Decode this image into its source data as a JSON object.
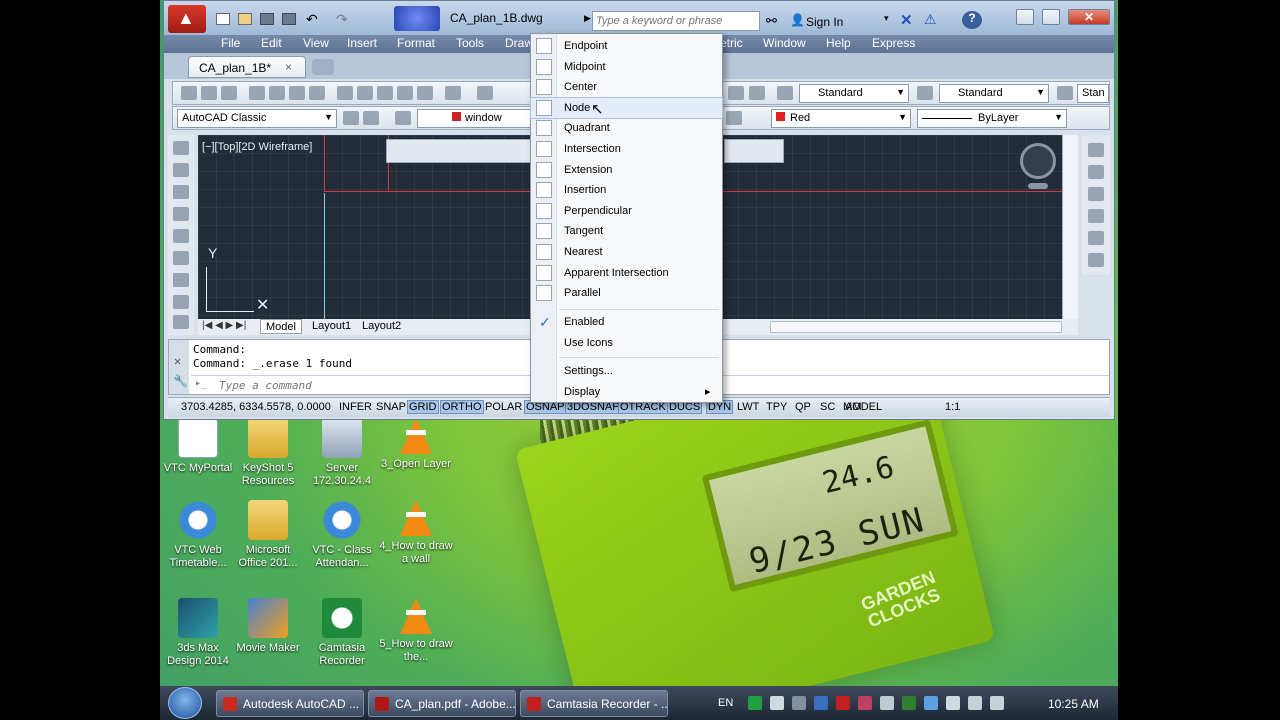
{
  "window": {
    "title": "CA_plan_1B.dwg",
    "search_placeholder": "Type a keyword or phrase",
    "sign_in": "Sign In"
  },
  "menus": [
    "File",
    "Edit",
    "View",
    "Insert",
    "Format",
    "Tools",
    "Draw",
    "etric",
    "Window",
    "Help",
    "Express"
  ],
  "file_tab": {
    "label": "CA_plan_1B*",
    "close": "×"
  },
  "toolbar": {
    "text_style": "Standard",
    "dim_style": "Standard",
    "table_style_partial": "Stan",
    "workspace": "AutoCAD Classic",
    "layer_partial": "window",
    "color": "Red",
    "linetype": "ByLayer"
  },
  "viewport": {
    "label": "[−][Top][2D Wireframe]",
    "axis_y": "Y"
  },
  "layout_tabs": [
    "Model",
    "Layout1",
    "Layout2"
  ],
  "command": {
    "line1": "Command:",
    "line2": "Command: _.erase 1 found",
    "placeholder": "Type a command"
  },
  "status": {
    "coords": "3703.4285, 6334.5578, 0.0000",
    "toggles": [
      "INFER",
      "SNAP",
      "GRID",
      "ORTHO",
      "POLAR",
      "OSNAP",
      "3DOSNAP",
      "OTRACK",
      "DUCS",
      "DYN",
      "LWT",
      "TPY",
      "QP",
      "SC",
      "AM"
    ],
    "active_toggles": [
      "GRID",
      "ORTHO",
      "OSNAP",
      "3DOSNAP",
      "OTRACK",
      "DUCS",
      "DYN"
    ],
    "model": "MODEL",
    "scale": "1:1"
  },
  "osnap_menu": {
    "items": [
      "Endpoint",
      "Midpoint",
      "Center",
      "Node",
      "Quadrant",
      "Intersection",
      "Extension",
      "Insertion",
      "Perpendicular",
      "Tangent",
      "Nearest",
      "Apparent Intersection",
      "Parallel"
    ],
    "hovered": "Node",
    "enabled": "Enabled",
    "use_icons": "Use Icons",
    "settings": "Settings...",
    "display": "Display",
    "display_arrow": "▸"
  },
  "desktop_icons": [
    {
      "label": "VTC MyPortal"
    },
    {
      "label": "KeyShot 5 Resources"
    },
    {
      "label": "Server 172.30.24.4"
    },
    {
      "label": "3_Open Layer"
    },
    {
      "label": "VTC Web Timetable..."
    },
    {
      "label": "Microsoft Office 201..."
    },
    {
      "label": "VTC - Class Attendan..."
    },
    {
      "label": "4_How to draw a wall"
    },
    {
      "label": "3ds Max Design 2014"
    },
    {
      "label": "Movie Maker"
    },
    {
      "label": "Camtasia Recorder"
    },
    {
      "label": "5_How to draw the..."
    }
  ],
  "clock": {
    "date": "9/23 SUN",
    "temp": "24.6",
    "brand_line1": "GARDEN",
    "brand_line2": "CLOCKS"
  },
  "taskbar": {
    "tasks": [
      "Autodesk AutoCAD ...",
      "CA_plan.pdf - Adobe...",
      "Camtasia Recorder - ..."
    ],
    "lang": "EN",
    "time": "10:25 AM"
  }
}
